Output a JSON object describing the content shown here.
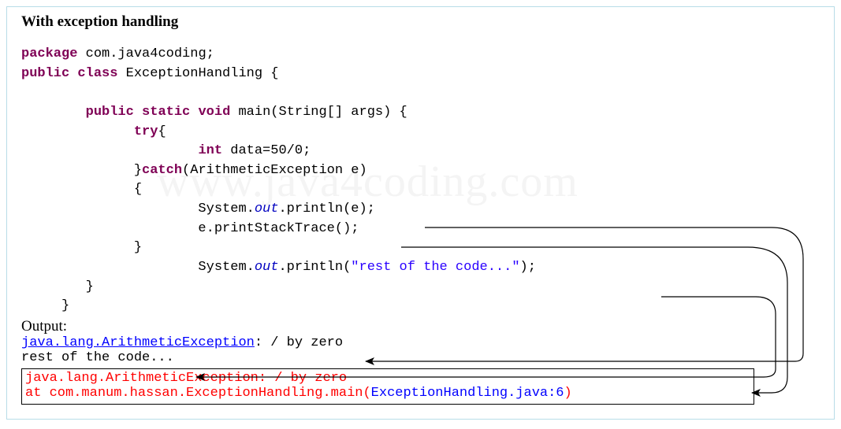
{
  "title": "With exception handling",
  "watermark": "www.java4coding.com",
  "code": {
    "l1_kw1": "package",
    "l1_sp": " com.java4coding;",
    "l2_kw1": "public",
    "l2_kw2": "class",
    "l2_sp": " ExceptionHandling {",
    "l3": "",
    "l4_indent": "        ",
    "l4_kw1": "public",
    "l4_kw2": "static",
    "l4_kw3": "void",
    "l4_sp": " main(String[] args) {",
    "l5_indent": "              ",
    "l5_kw": "try",
    "l5_sp": "{",
    "l6_indent": "                      ",
    "l6_kw": "int",
    "l6_sp": " data=50/0;",
    "l7_indent": "              }",
    "l7_kw": "catch",
    "l7_sp": "(ArithmeticException e)",
    "l8_indent": "              {",
    "l9_indent": "                      System.",
    "l9_out": "out",
    "l9_sp": ".println(e);",
    "l10_indent": "                      e.printStackTrace();",
    "l11_indent": "              }",
    "l12_indent": "                      System.",
    "l12_out": "out",
    "l12_mid": ".println(",
    "l12_str": "\"rest of the code...\"",
    "l12_end": ");",
    "l13_indent": "        }",
    "l14_indent": "     }"
  },
  "output_label": "Output:",
  "out1_a": "java.lang.ArithmeticException",
  "out1_b": ": / by zero",
  "out2": "rest of the code...",
  "trace": {
    "l1_a": "java.lang.ArithmeticException: / by zero",
    "l2_indent": "       at com.manum.hassan.ExceptionHandling.main(",
    "l2_link": "ExceptionHandling.java:6",
    "l2_end": ")"
  }
}
